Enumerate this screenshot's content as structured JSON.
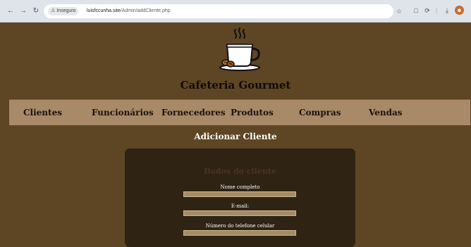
{
  "browser": {
    "security_label": "Inseguro",
    "url_domain": "luisfccunha.site",
    "url_path": "/Admin/addCliente.php"
  },
  "site": {
    "title": "Cafeteria Gourmet",
    "logo_icon": "coffee-cup-icon"
  },
  "menu": {
    "items": [
      {
        "label": "Clientes"
      },
      {
        "label": "Funcionários"
      },
      {
        "label": "Fornecedores"
      },
      {
        "label": "Produtos"
      },
      {
        "label": "Compras"
      },
      {
        "label": "Vendas"
      }
    ]
  },
  "page": {
    "title": "Adicionar Cliente"
  },
  "form": {
    "title": "Dados do cliente",
    "fields": [
      {
        "label": "Nome completo",
        "value": ""
      },
      {
        "label": "E-mail:",
        "value": ""
      },
      {
        "label": "Número do telefone celular",
        "value": ""
      }
    ]
  },
  "colors": {
    "background": "#5e4524",
    "menu_bar": "#a88968",
    "card": "#2f2314",
    "input": "#a68c66"
  }
}
